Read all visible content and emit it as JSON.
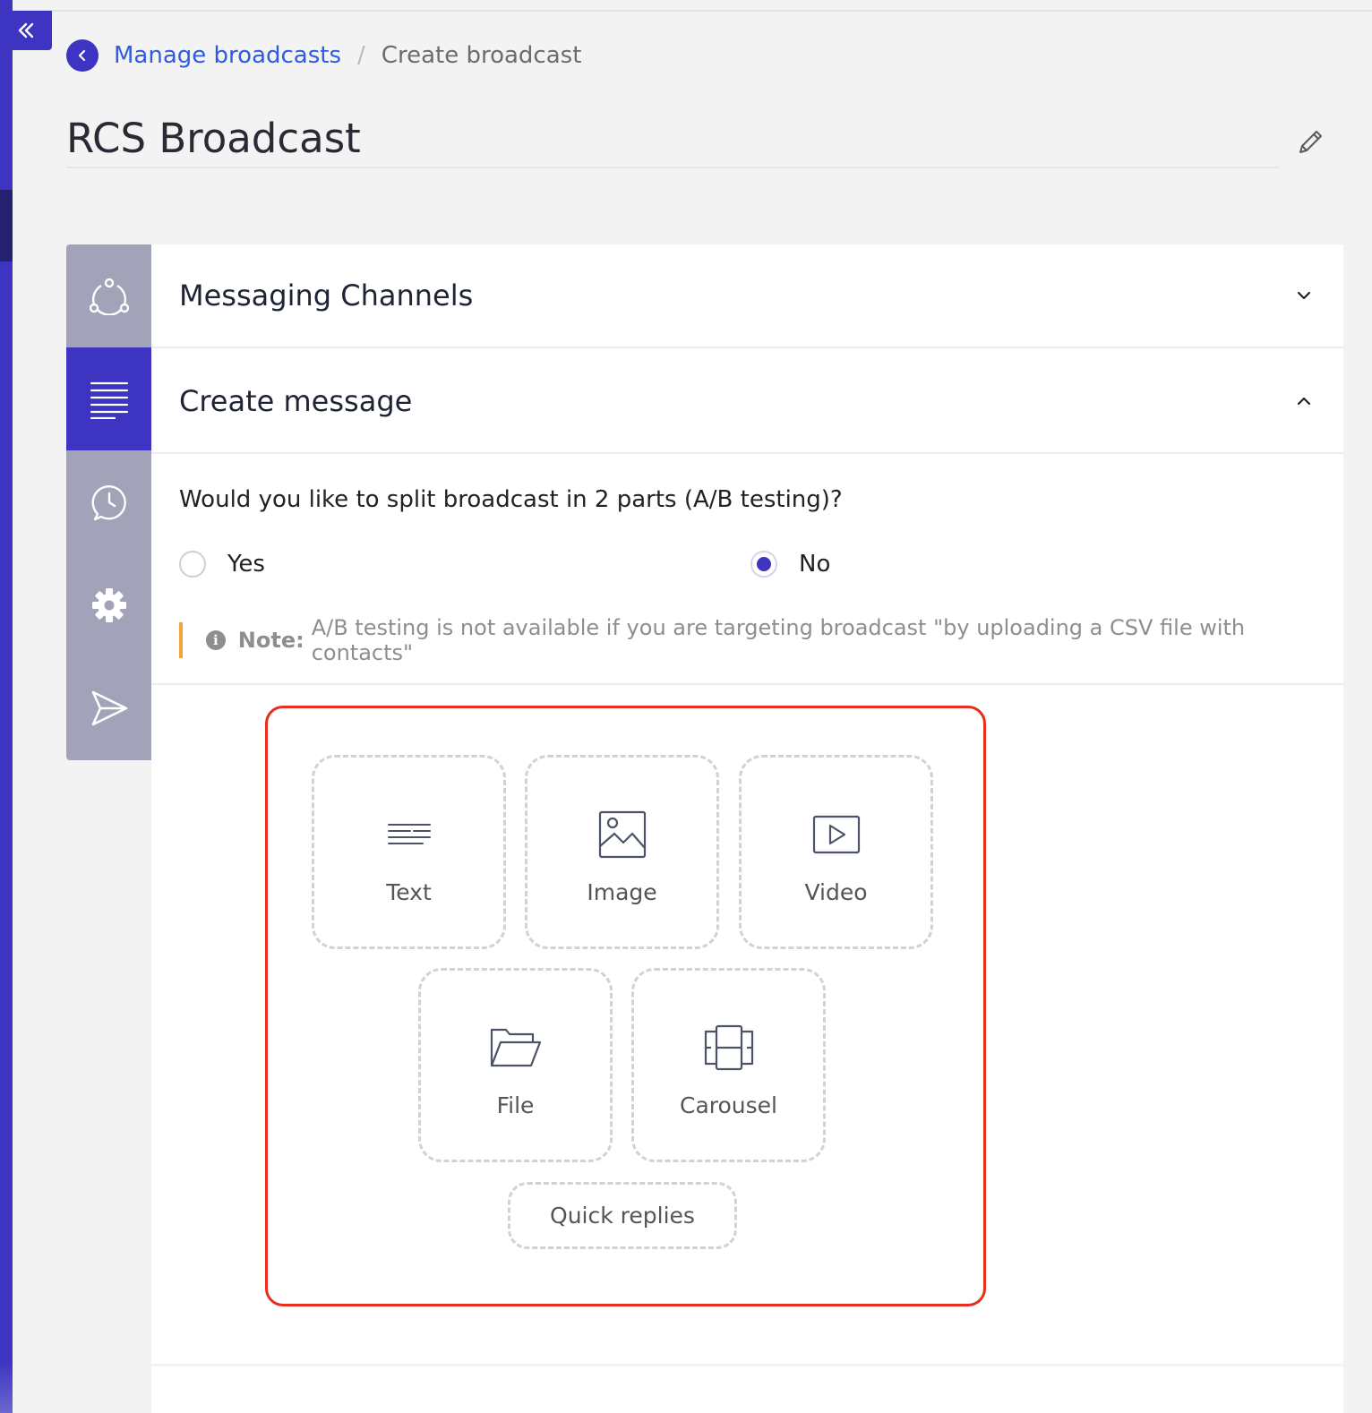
{
  "breadcrumb": {
    "parent": "Manage broadcasts",
    "separator": "/",
    "current": "Create broadcast"
  },
  "page": {
    "title": "RCS Broadcast"
  },
  "steps": [
    {
      "name": "messaging-channels",
      "icon": "channels-icon"
    },
    {
      "name": "create-message",
      "icon": "message-lines-icon",
      "active": true
    },
    {
      "name": "schedule",
      "icon": "clock-chat-icon"
    },
    {
      "name": "settings",
      "icon": "gear-icon"
    },
    {
      "name": "send",
      "icon": "send-icon"
    }
  ],
  "sections": {
    "messaging_channels": {
      "title": "Messaging Channels",
      "expanded": false
    },
    "create_message": {
      "title": "Create message",
      "expanded": true
    }
  },
  "ab_test": {
    "question": "Would you like to split broadcast in 2 parts (A/B testing)?",
    "options": [
      {
        "label": "Yes",
        "selected": false
      },
      {
        "label": "No",
        "selected": true
      }
    ],
    "note_label": "Note:",
    "note_text": "A/B testing is not available if you are targeting broadcast \"by uploading a CSV file with contacts\""
  },
  "message_types": {
    "tiles": [
      {
        "label": "Text",
        "icon": "text-lines-icon"
      },
      {
        "label": "Image",
        "icon": "image-icon"
      },
      {
        "label": "Video",
        "icon": "video-play-icon"
      },
      {
        "label": "File",
        "icon": "folder-icon"
      },
      {
        "label": "Carousel",
        "icon": "carousel-icon"
      }
    ],
    "quick_replies": "Quick replies"
  },
  "colors": {
    "brand": "#3d34c2",
    "link": "#2f5be0",
    "highlight": "#ea2c1f",
    "note_accent": "#f3a43a",
    "rail_inactive": "#a2a3b8"
  }
}
